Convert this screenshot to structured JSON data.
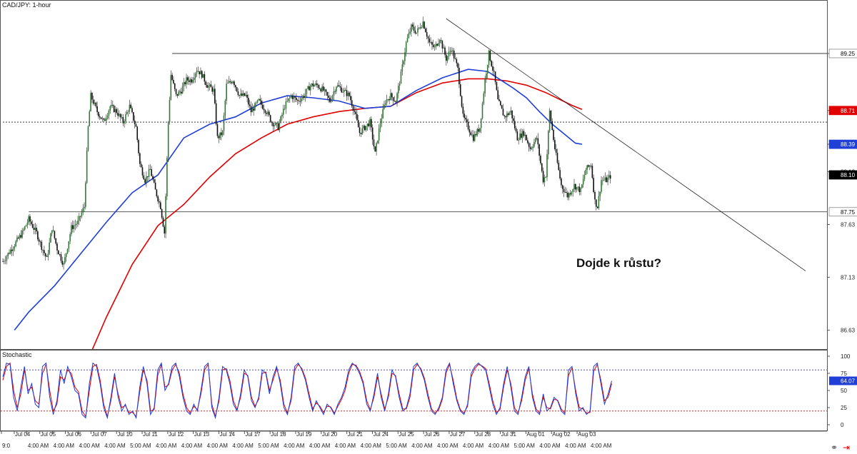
{
  "chart_data": [
    {
      "type": "candlestick",
      "title": "CAD/JPY: 1-hour",
      "ylim": [
        86.45,
        89.75
      ],
      "price_ticks": [
        "89.25",
        "88.71",
        "88.39",
        "88.13",
        "87.63",
        "87.13",
        "86.63"
      ],
      "time_labels": [
        "9:0",
        "Jul 04",
        "4:00 AM",
        "Jul 05",
        "4:00 AM",
        "Jul 06",
        "4:00 AM",
        "Jul 07",
        "4:00 AM",
        "Jul 10",
        "5:00 AM",
        "Jul 11",
        "4:00 AM",
        "Jul 12",
        "4:00 AM",
        "Jul 13",
        "4:00 AM",
        "Jul 14",
        "4:00 AM",
        "Jul 17",
        "5:00 AM",
        "Jul 18",
        "4:00 AM",
        "Jul 19",
        "4:00 AM",
        "Jul 20",
        "4:00 AM",
        "Jul 21",
        "4:00 AM",
        "Jul 24",
        "5:00 AM",
        "Jul 25",
        "4:00 AM",
        "Jul 26",
        "4:00 AM",
        "Jul 27",
        "4:00 AM",
        "Jul 28",
        "4:00 AM",
        "Jul 31",
        "5:00 AM",
        "Aug 01",
        "4:00 AM",
        "Aug 02",
        "4:00 AM",
        "Aug 03",
        "4:00 AM"
      ],
      "price_path": [
        {
          "x": 0,
          "y": 87.28
        },
        {
          "x": 1.5,
          "y": 87.55
        },
        {
          "x": 2,
          "y": 87.68
        },
        {
          "x": 2.6,
          "y": 87.55
        },
        {
          "x": 3,
          "y": 87.42
        },
        {
          "x": 3.4,
          "y": 87.3
        },
        {
          "x": 3.8,
          "y": 87.6
        },
        {
          "x": 4.2,
          "y": 87.4
        },
        {
          "x": 4.7,
          "y": 87.25
        },
        {
          "x": 5.3,
          "y": 87.6
        },
        {
          "x": 5.8,
          "y": 87.65
        },
        {
          "x": 6.3,
          "y": 87.8
        },
        {
          "x": 6.6,
          "y": 88.55
        },
        {
          "x": 6.8,
          "y": 88.85
        },
        {
          "x": 7.3,
          "y": 88.7
        },
        {
          "x": 7.8,
          "y": 88.6
        },
        {
          "x": 8.3,
          "y": 88.75
        },
        {
          "x": 8.8,
          "y": 88.7
        },
        {
          "x": 9.3,
          "y": 88.6
        },
        {
          "x": 9.8,
          "y": 88.75
        },
        {
          "x": 10.3,
          "y": 88.55
        },
        {
          "x": 10.6,
          "y": 88.2
        },
        {
          "x": 11.0,
          "y": 88.05
        },
        {
          "x": 11.4,
          "y": 88.15
        },
        {
          "x": 11.8,
          "y": 87.95
        },
        {
          "x": 12.2,
          "y": 87.8
        },
        {
          "x": 12.5,
          "y": 87.55
        },
        {
          "x": 12.8,
          "y": 88.6
        },
        {
          "x": 13.0,
          "y": 89.05
        },
        {
          "x": 13.4,
          "y": 88.85
        },
        {
          "x": 13.8,
          "y": 88.9
        },
        {
          "x": 14.2,
          "y": 89.0
        },
        {
          "x": 14.6,
          "y": 89.0
        },
        {
          "x": 15.0,
          "y": 89.1
        },
        {
          "x": 15.4,
          "y": 89.05
        },
        {
          "x": 15.8,
          "y": 88.95
        },
        {
          "x": 16.3,
          "y": 88.9
        },
        {
          "x": 16.6,
          "y": 88.45
        },
        {
          "x": 17.0,
          "y": 88.5
        },
        {
          "x": 17.3,
          "y": 88.95
        },
        {
          "x": 17.8,
          "y": 89.0
        },
        {
          "x": 18.3,
          "y": 88.85
        },
        {
          "x": 18.8,
          "y": 88.85
        },
        {
          "x": 19.2,
          "y": 88.7
        },
        {
          "x": 19.8,
          "y": 88.8
        },
        {
          "x": 20.4,
          "y": 88.7
        },
        {
          "x": 20.8,
          "y": 88.6
        },
        {
          "x": 21.3,
          "y": 88.55
        },
        {
          "x": 21.8,
          "y": 88.75
        },
        {
          "x": 22.3,
          "y": 88.85
        },
        {
          "x": 22.8,
          "y": 88.8
        },
        {
          "x": 23.3,
          "y": 88.85
        },
        {
          "x": 23.8,
          "y": 88.95
        },
        {
          "x": 24.3,
          "y": 88.95
        },
        {
          "x": 24.8,
          "y": 88.9
        },
        {
          "x": 25.3,
          "y": 88.8
        },
        {
          "x": 25.8,
          "y": 88.95
        },
        {
          "x": 26.3,
          "y": 88.9
        },
        {
          "x": 26.8,
          "y": 88.85
        },
        {
          "x": 27.2,
          "y": 88.7
        },
        {
          "x": 27.6,
          "y": 88.5
        },
        {
          "x": 28.0,
          "y": 88.55
        },
        {
          "x": 28.4,
          "y": 88.6
        },
        {
          "x": 28.8,
          "y": 88.3
        },
        {
          "x": 29.2,
          "y": 88.6
        },
        {
          "x": 29.6,
          "y": 88.8
        },
        {
          "x": 30.0,
          "y": 88.85
        },
        {
          "x": 30.4,
          "y": 88.8
        },
        {
          "x": 30.8,
          "y": 89.05
        },
        {
          "x": 31.2,
          "y": 89.35
        },
        {
          "x": 31.6,
          "y": 89.5
        },
        {
          "x": 32.0,
          "y": 89.45
        },
        {
          "x": 32.5,
          "y": 89.55
        },
        {
          "x": 33.0,
          "y": 89.35
        },
        {
          "x": 33.4,
          "y": 89.3
        },
        {
          "x": 33.8,
          "y": 89.4
        },
        {
          "x": 34.3,
          "y": 89.2
        },
        {
          "x": 34.7,
          "y": 89.3
        },
        {
          "x": 35.2,
          "y": 89.1
        },
        {
          "x": 35.6,
          "y": 88.65
        },
        {
          "x": 36.0,
          "y": 88.55
        },
        {
          "x": 36.4,
          "y": 88.45
        },
        {
          "x": 36.9,
          "y": 88.55
        },
        {
          "x": 37.3,
          "y": 89.0
        },
        {
          "x": 37.6,
          "y": 89.25
        },
        {
          "x": 38.0,
          "y": 89.05
        },
        {
          "x": 38.3,
          "y": 88.8
        },
        {
          "x": 38.8,
          "y": 88.65
        },
        {
          "x": 39.3,
          "y": 88.7
        },
        {
          "x": 39.8,
          "y": 88.45
        },
        {
          "x": 40.3,
          "y": 88.5
        },
        {
          "x": 40.8,
          "y": 88.35
        },
        {
          "x": 41.3,
          "y": 88.45
        },
        {
          "x": 41.8,
          "y": 88.05
        },
        {
          "x": 42.0,
          "y": 88.1
        },
        {
          "x": 42.3,
          "y": 88.7
        },
        {
          "x": 42.7,
          "y": 88.35
        },
        {
          "x": 43.2,
          "y": 88.0
        },
        {
          "x": 43.7,
          "y": 87.9
        },
        {
          "x": 44.2,
          "y": 88.0
        },
        {
          "x": 44.7,
          "y": 87.95
        },
        {
          "x": 45.1,
          "y": 88.15
        },
        {
          "x": 45.5,
          "y": 88.2
        },
        {
          "x": 45.8,
          "y": 87.85
        },
        {
          "x": 46.0,
          "y": 87.8
        },
        {
          "x": 46.3,
          "y": 88.05
        },
        {
          "x": 46.7,
          "y": 88.05
        },
        {
          "x": 47.1,
          "y": 88.1
        }
      ],
      "ma_fast_blue": [
        {
          "x": 0.9,
          "y": 86.63
        },
        {
          "x": 2,
          "y": 86.8
        },
        {
          "x": 4,
          "y": 87.05
        },
        {
          "x": 6,
          "y": 87.35
        },
        {
          "x": 8,
          "y": 87.65
        },
        {
          "x": 10,
          "y": 87.93
        },
        {
          "x": 12,
          "y": 88.1
        },
        {
          "x": 14,
          "y": 88.45
        },
        {
          "x": 16,
          "y": 88.58
        },
        {
          "x": 18,
          "y": 88.65
        },
        {
          "x": 20,
          "y": 88.78
        },
        {
          "x": 22,
          "y": 88.85
        },
        {
          "x": 24,
          "y": 88.83
        },
        {
          "x": 26,
          "y": 88.8
        },
        {
          "x": 28,
          "y": 88.73
        },
        {
          "x": 30,
          "y": 88.75
        },
        {
          "x": 32,
          "y": 88.9
        },
        {
          "x": 34,
          "y": 89.02
        },
        {
          "x": 36,
          "y": 89.1
        },
        {
          "x": 37.5,
          "y": 89.08
        },
        {
          "x": 38.5,
          "y": 89.0
        },
        {
          "x": 39.5,
          "y": 88.92
        },
        {
          "x": 40.5,
          "y": 88.83
        },
        {
          "x": 41.5,
          "y": 88.7
        },
        {
          "x": 42.5,
          "y": 88.58
        },
        {
          "x": 43.3,
          "y": 88.5
        },
        {
          "x": 43.8,
          "y": 88.45
        },
        {
          "x": 44.3,
          "y": 88.4
        },
        {
          "x": 44.8,
          "y": 88.39
        }
      ],
      "ma_slow_red": [
        {
          "x": 6.9,
          "y": 86.44
        },
        {
          "x": 8,
          "y": 86.75
        },
        {
          "x": 10,
          "y": 87.25
        },
        {
          "x": 12,
          "y": 87.62
        },
        {
          "x": 14,
          "y": 87.82
        },
        {
          "x": 16,
          "y": 88.08
        },
        {
          "x": 18,
          "y": 88.3
        },
        {
          "x": 20,
          "y": 88.45
        },
        {
          "x": 22,
          "y": 88.58
        },
        {
          "x": 24,
          "y": 88.65
        },
        {
          "x": 26,
          "y": 88.7
        },
        {
          "x": 28,
          "y": 88.73
        },
        {
          "x": 30,
          "y": 88.75
        },
        {
          "x": 32,
          "y": 88.88
        },
        {
          "x": 34,
          "y": 88.97
        },
        {
          "x": 36,
          "y": 89.01
        },
        {
          "x": 37.5,
          "y": 89.01
        },
        {
          "x": 39,
          "y": 88.99
        },
        {
          "x": 40.5,
          "y": 88.95
        },
        {
          "x": 42,
          "y": 88.88
        },
        {
          "x": 43,
          "y": 88.82
        },
        {
          "x": 44,
          "y": 88.76
        },
        {
          "x": 44.8,
          "y": 88.72
        }
      ],
      "levels": [
        {
          "y": 89.25,
          "style": "solid",
          "from_x": 13.1
        },
        {
          "y": 88.6,
          "style": "dotted",
          "from_x": 0
        },
        {
          "y": 87.75,
          "style": "solid",
          "from_x": 2
        }
      ],
      "trendline": {
        "x1": 34.3,
        "y1": 89.58,
        "x2": 62.1,
        "y2": 87.19
      },
      "badges": [
        {
          "label": "89.25",
          "y": 89.25,
          "bg": "#ffffff",
          "fg": "#000000",
          "border": "#888888"
        },
        {
          "label": "88.71",
          "y": 88.71,
          "bg": "#e00000",
          "fg": "#ffffff",
          "border": "#e00000"
        },
        {
          "label": "88.39",
          "y": 88.39,
          "bg": "#1f3fd6",
          "fg": "#ffffff",
          "border": "#1f3fd6"
        },
        {
          "label": "88.10",
          "y": 88.1,
          "bg": "#000000",
          "fg": "#ffffff",
          "border": "#000000"
        },
        {
          "label": "87.75",
          "y": 87.75,
          "bg": "#ffffff",
          "fg": "#000000",
          "border": "#888888"
        }
      ],
      "annotation": {
        "text": "Dojde k růstu?",
        "x": 43.1,
        "y": 87.63
      }
    },
    {
      "type": "line",
      "title": "Stochastic",
      "ylim": [
        0,
        100
      ],
      "y_ticks": [
        "100",
        "75",
        "50",
        "25",
        "0"
      ],
      "overbought": 80,
      "oversold": 20,
      "current_label": "64.07",
      "current_value": 64.07,
      "k_line": [
        70,
        90,
        88,
        40,
        20,
        55,
        85,
        45,
        60,
        30,
        25,
        85,
        90,
        40,
        15,
        35,
        80,
        60,
        85,
        70,
        50,
        45,
        15,
        10,
        60,
        90,
        85,
        60,
        25,
        10,
        40,
        75,
        40,
        20,
        30,
        15,
        20,
        10,
        55,
        85,
        60,
        15,
        25,
        80,
        90,
        50,
        60,
        85,
        90,
        70,
        40,
        20,
        15,
        30,
        20,
        50,
        85,
        90,
        25,
        10,
        40,
        85,
        80,
        60,
        30,
        20,
        45,
        80,
        70,
        35,
        25,
        40,
        80,
        75,
        45,
        70,
        85,
        60,
        25,
        15,
        40,
        85,
        90,
        80,
        65,
        40,
        20,
        35,
        25,
        15,
        30,
        25,
        15,
        30,
        40,
        55,
        80,
        90,
        85,
        75,
        60,
        30,
        20,
        45,
        75,
        40,
        20,
        45,
        80,
        70,
        40,
        20,
        25,
        45,
        85,
        90,
        80,
        65,
        40,
        20,
        15,
        25,
        40,
        80,
        90,
        60,
        35,
        20,
        15,
        30,
        75,
        85,
        90,
        85,
        80,
        55,
        30,
        15,
        25,
        60,
        85,
        55,
        20,
        15,
        40,
        70,
        85,
        40,
        20,
        15,
        45,
        20,
        25,
        40,
        35,
        20,
        15,
        80,
        85,
        45,
        20,
        25,
        15,
        20,
        85,
        90,
        60,
        30,
        45,
        64
      ],
      "d_line": [
        65,
        85,
        90,
        50,
        25,
        45,
        80,
        50,
        55,
        35,
        30,
        75,
        88,
        50,
        20,
        30,
        70,
        65,
        80,
        75,
        55,
        48,
        20,
        12,
        50,
        85,
        88,
        65,
        30,
        12,
        35,
        70,
        45,
        25,
        28,
        18,
        18,
        12,
        48,
        80,
        65,
        20,
        22,
        72,
        88,
        55,
        58,
        80,
        88,
        75,
        45,
        25,
        17,
        27,
        22,
        45,
        80,
        88,
        30,
        12,
        35,
        80,
        82,
        65,
        35,
        22,
        40,
        75,
        72,
        40,
        27,
        37,
        75,
        77,
        50,
        65,
        82,
        65,
        30,
        17,
        35,
        80,
        88,
        82,
        68,
        45,
        23,
        32,
        27,
        18,
        27,
        26,
        17,
        27,
        37,
        50,
        75,
        88,
        87,
        78,
        63,
        35,
        22,
        40,
        70,
        45,
        23,
        40,
        75,
        72,
        45,
        23,
        23,
        40,
        80,
        88,
        82,
        68,
        45,
        23,
        17,
        22,
        37,
        75,
        88,
        65,
        38,
        22,
        17,
        27,
        70,
        82,
        88,
        86,
        82,
        60,
        35,
        18,
        22,
        55,
        80,
        60,
        25,
        17,
        35,
        65,
        82,
        45,
        23,
        17,
        40,
        25,
        23,
        37,
        36,
        23,
        17,
        72,
        83,
        50,
        25,
        23,
        17,
        18,
        78,
        88,
        65,
        35,
        40,
        60
      ]
    }
  ],
  "colors": {
    "bull_candle": "#2e7d32",
    "bear_candle": "#111111",
    "ma_fast": "#1f3fd6",
    "ma_slow": "#e00000",
    "stoch_k": "#1f3fd6",
    "stoch_d": "#e00000",
    "overbought_line": "#3030c0",
    "oversold_line": "#e00000"
  },
  "icons": [
    "link-icon",
    "arrow-right-icon"
  ]
}
